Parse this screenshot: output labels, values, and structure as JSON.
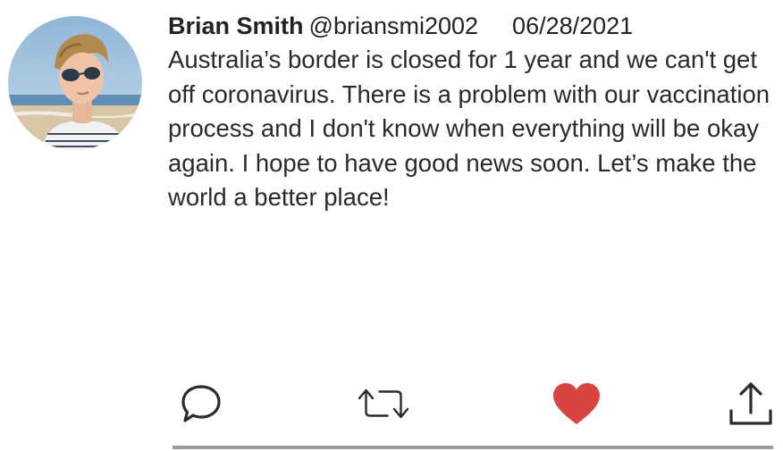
{
  "tweet": {
    "author_name": "Brian Smith",
    "author_handle": "@briansmi2002",
    "date": "06/28/2021",
    "text": "Australia’s border is closed for 1 year and we can't get off coronavirus. There is a problem with our vaccination process and I don't know when everything will be okay again. I hope to have good news soon. Let’s make the world a better place!"
  },
  "actions": {
    "reply_icon": "speech-bubble-icon",
    "retweet_icon": "retweet-arrows-icon",
    "like_icon": "heart-icon",
    "share_icon": "share-upload-icon",
    "like_color": "#d9443f",
    "liked": true
  },
  "colors": {
    "text": "#222222",
    "divider": "#9a9a9a"
  }
}
